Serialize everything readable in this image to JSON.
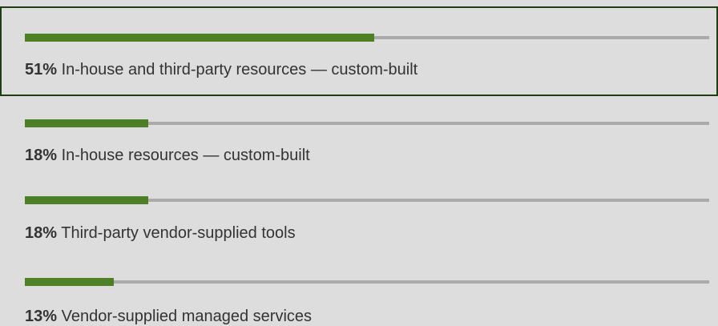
{
  "colors": {
    "bar_fill": "#4d7f24",
    "bar_track": "#aaaaaa",
    "selected_border": "#1f3d12",
    "background": "#dddddd"
  },
  "chart_data": {
    "type": "bar",
    "orientation": "horizontal",
    "categories": [
      "In-house and third-party resources — custom-built",
      "In-house resources — custom-built",
      "Third-party vendor-supplied tools",
      "Vendor-supplied managed services"
    ],
    "values": [
      51,
      18,
      18,
      13
    ],
    "value_labels": [
      "51%",
      "18%",
      "18%",
      "13%"
    ],
    "xlim": [
      0,
      100
    ],
    "selected_index": 0
  }
}
